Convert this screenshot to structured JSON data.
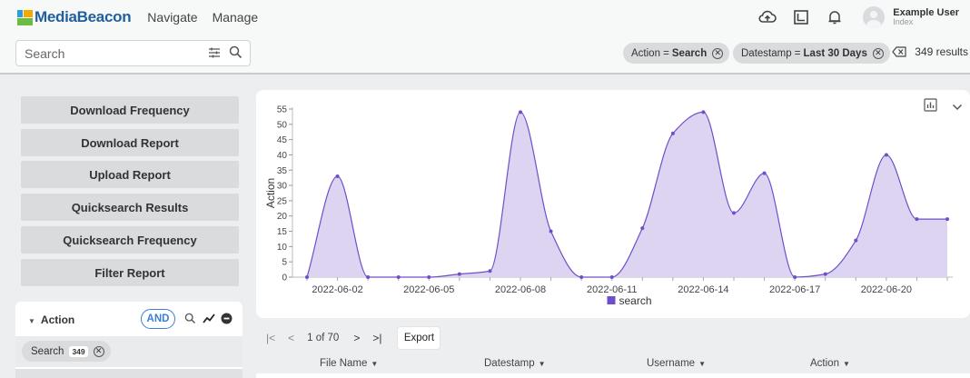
{
  "header": {
    "brand": "MediaBeacon",
    "nav": [
      "Navigate",
      "Manage"
    ],
    "user_name": "Example User",
    "user_sub": "Index"
  },
  "search": {
    "placeholder": "Search",
    "filters": [
      {
        "key": "Action = ",
        "value": "Search"
      },
      {
        "key": "Datestamp = ",
        "value": "Last 30 Days"
      }
    ],
    "results": "349 results"
  },
  "reports": [
    "Download Frequency",
    "Download Report",
    "Upload Report",
    "Quicksearch Results",
    "Quicksearch Frequency",
    "Filter Report"
  ],
  "facet": {
    "title": "Action",
    "operator": "AND",
    "chip_label": "Search",
    "chip_count": "349"
  },
  "chart_data": {
    "type": "area",
    "ylabel": "Action",
    "xlabel": "",
    "ylim": [
      0,
      55
    ],
    "yticks": [
      0,
      5,
      10,
      15,
      20,
      25,
      30,
      35,
      40,
      45,
      50,
      55
    ],
    "x_tick_labels": [
      "2022-06-02",
      "2022-06-05",
      "2022-06-08",
      "2022-06-11",
      "2022-06-14",
      "2022-06-17",
      "2022-06-20"
    ],
    "x": [
      "2022-06-01",
      "2022-06-02",
      "2022-06-03",
      "2022-06-04",
      "2022-06-05",
      "2022-06-06",
      "2022-06-07",
      "2022-06-08",
      "2022-06-09",
      "2022-06-10",
      "2022-06-11",
      "2022-06-12",
      "2022-06-13",
      "2022-06-14",
      "2022-06-15",
      "2022-06-16",
      "2022-06-17",
      "2022-06-18",
      "2022-06-19",
      "2022-06-20",
      "2022-06-21",
      "2022-06-22"
    ],
    "series": [
      {
        "name": "search",
        "values": [
          0,
          33,
          0,
          0,
          0,
          1,
          2,
          54,
          15,
          0,
          0,
          16,
          47,
          54,
          21,
          34,
          0,
          1,
          12,
          40,
          19,
          19
        ]
      }
    ],
    "legend_position": "bottom",
    "color": "#6f4fc9",
    "fill": "#ddd4f2"
  },
  "pager": {
    "page_text": "1 of 70",
    "export_label": "Export"
  },
  "columns": [
    "File Name",
    "Datestamp",
    "Username",
    "Action"
  ]
}
